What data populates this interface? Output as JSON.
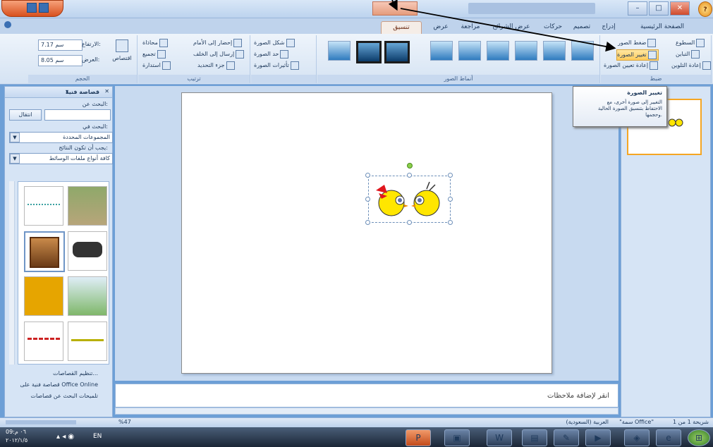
{
  "window": {
    "title": "",
    "context_tab": ""
  },
  "tabs": [
    "الصفحة الرئيسية",
    "إدراج",
    "تصميم",
    "حركات",
    "عرض الشرائح",
    "مراجعة",
    "عرض",
    "تنسيق"
  ],
  "ribbon": {
    "adjust": {
      "label": "ضبط",
      "brightness": "السطوع",
      "contrast": "التباين",
      "recolor": "إعادة التلوين",
      "compress": "ضغط الصور",
      "change_picture": "تغيير الصورة",
      "reset_picture": "إعادة تعيين الصورة"
    },
    "picture_styles": {
      "label": "أنماط الصور",
      "shape": "شكل الصورة",
      "border": "حد الصورة",
      "effects": "تأثيرات الصورة"
    },
    "arrange": {
      "label": "ترتيب",
      "bring_front": "إحضار إلى الأمام",
      "send_back": "إرسال إلى الخلف",
      "selection_pane": "جزء التحديد",
      "align": "محاذاة",
      "group": "تجميع",
      "rotate": "استدارة"
    },
    "size": {
      "label": "الحجم",
      "crop": "اقتصاص",
      "height": "7.17 سم",
      "width": "8.05 سم",
      "height_label": "الارتفاع:",
      "width_label": "العرض:"
    }
  },
  "left_pane": {
    "title": "قصاصة فنية",
    "search_label": "البحث عن:",
    "search_value": "",
    "go_button": "انتقال",
    "search_in_label": "البحث في:",
    "search_in_value": "المجموعات المحددة",
    "results_label": "يجب أن تكون النتائج:",
    "results_value": "كافة أنواع ملفات الوسائط",
    "organize": "تنظيم القصاصات...",
    "online": "قصاصة فنية على Office Online",
    "tips": "تلميحات البحث عن قصاصات"
  },
  "tooltip": {
    "title": "تغيير الصورة",
    "body": "التغيير إلى صورة أخرى، مع الاحتفاظ بتنسيق الصورة الحالية وحجمها."
  },
  "notes": {
    "placeholder": "انقر لإضافة ملاحظات"
  },
  "status": {
    "slide": "شريحة 1 من 1",
    "theme": "\"سمة Office\"",
    "language": "العربية (السعودية)",
    "zoom": "%47"
  },
  "taskbar": {
    "lang": "EN",
    "time": "09:٠٦ م",
    "date": "٢٠١٢/١/٥"
  }
}
